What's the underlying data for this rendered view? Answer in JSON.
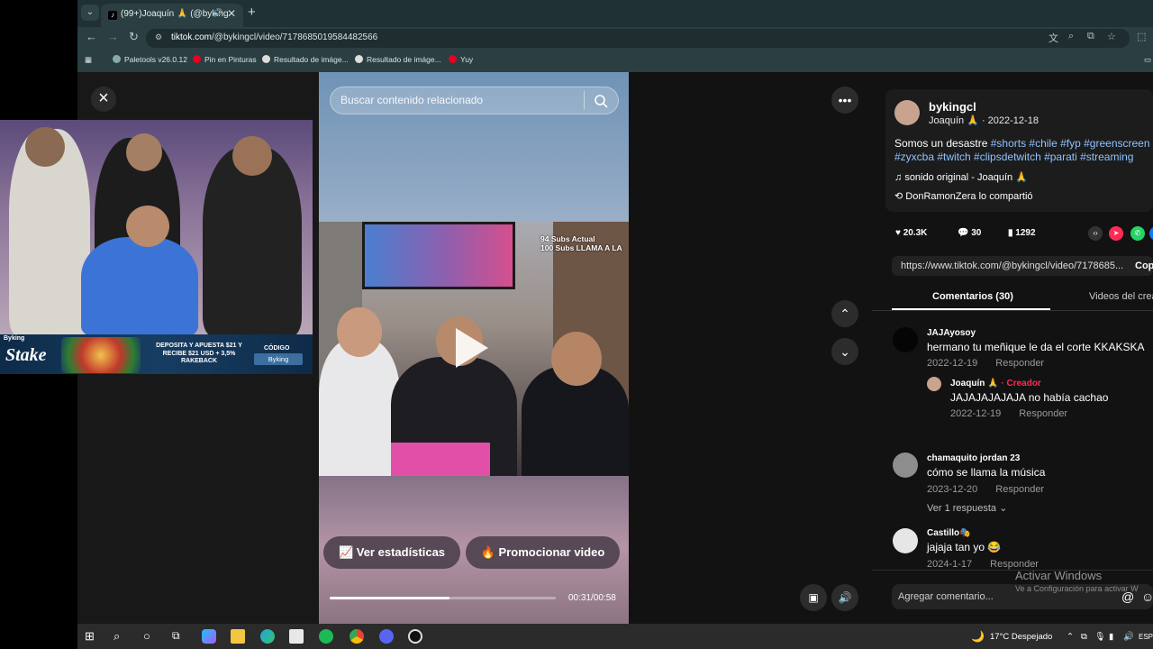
{
  "browser": {
    "tab_title": "(99+)Joaquín 🙏 (@byking",
    "url_domain": "tiktok.com",
    "url_path": "/@bykingcl/video/7178685019584482566",
    "bookmarks": [
      "Paletools v26.0.12",
      "Pin en Pinturas",
      "Resultado de imáge...",
      "Resultado de imáge...",
      "Yuy"
    ]
  },
  "stream_overlay": {
    "streamer": "Byking",
    "sponsor": "Stake",
    "promo_text": "DEPOSITA Y APUESTA $21 Y RECIBE $21 USD + 3,5% RAKEBACK",
    "code_label": "CÓDIGO",
    "code_value": "Byking"
  },
  "video": {
    "search_placeholder": "Buscar contenido relacionado",
    "overlay_subs": "94 Subs Actual\n100 Subs LLAMA A LA",
    "stats_button": "Ver estadísticas",
    "promote_button": "Promocionar video",
    "time": "00:31/00:58",
    "progress": 0.53
  },
  "post": {
    "username": "bykingcl",
    "display": "Joaquín 🙏 · 2022-12-18",
    "description_plain": "Somos un desastre ",
    "tags_line1": "#shorts #chile #fyp #greenscreen",
    "tags_line2": "#zyxcba #twitch #clipsdetwitch #parati #streaming",
    "sound": "sonido original - Joaquín 🙏",
    "shared_by": "DonRamonZera lo compartió",
    "likes": "20.3K",
    "comments": "30",
    "saves": "1292",
    "link": "https://www.tiktok.com/@bykingcl/video/7178685...",
    "copy_label": "Copi",
    "tab_comments": "Comentarios (30)",
    "tab_videos": "Videos del crea"
  },
  "comments": [
    {
      "user": "JAJAyosoy",
      "text": "hermano tu meñique le da el corte KKAKSKA",
      "date": "2022-12-19",
      "reply": "Responder"
    },
    {
      "user": "Joaquín 🙏",
      "creator": "· Creador",
      "text": "JAJAJAJAJAJA no había cachao",
      "date": "2022-12-19",
      "reply": "Responder"
    },
    {
      "user": "chamaquito jordan 23",
      "text": "cómo se llama la música",
      "date": "2023-12-20",
      "reply": "Responder",
      "more": "Ver 1 respuesta ⌄"
    },
    {
      "user": "Castillo🎭",
      "text": "jajaja tan yo 😂",
      "date": "2024-1-17",
      "reply": "Responder"
    }
  ],
  "comment_input": "Agregar comentario...",
  "windows_watermark": {
    "line1": "Activar Windows",
    "line2": "Ve a Configuración para activar W"
  },
  "taskbar": {
    "weather": "17°C  Despejado",
    "lang": "ESP"
  },
  "colors": {
    "tiktok_red": "#fe2c55",
    "hashtag": "#8fc2ff"
  }
}
